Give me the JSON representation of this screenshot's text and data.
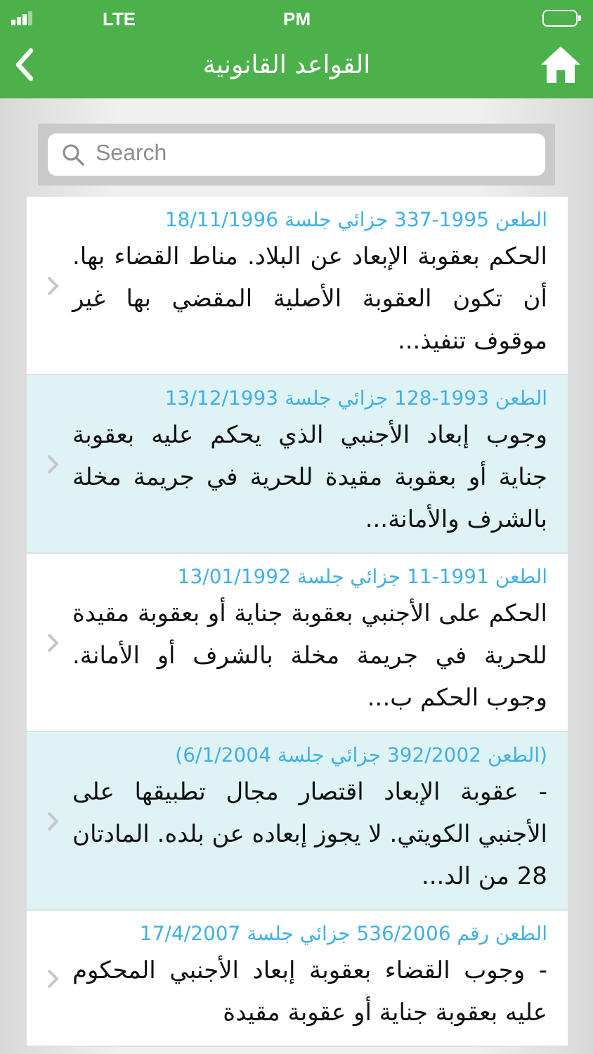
{
  "status_bar": {
    "network": "LTE",
    "time": "PM"
  },
  "nav_bar": {
    "title": "القواعد القانونية"
  },
  "search": {
    "placeholder": "Search"
  },
  "rulings": [
    {
      "header": "الطعن 1995-337 جزائي جلسة 18/11/1996",
      "summary": "الحكم بعقوبة الإبعاد عن البلاد. مناط القضاء بها. أن تكون العقوبة الأصلية المقضي بها غير موقوف تنفيذ..."
    },
    {
      "header": "الطعن 1993-128 جزائي جلسة 13/12/1993",
      "summary": "وجوب إبعاد الأجنبي الذي يحكم عليه بعقوبة جناية أو بعقوبة مقيدة للحرية في جريمة مخلة بالشرف والأمانة..."
    },
    {
      "header": "الطعن 1991-11 جزائي جلسة 13/01/1992",
      "summary": "الحكم على الأجنبي بعقوبة جناية أو بعقوبة مقيدة للحرية في جريمة مخلة بالشرف أو الأمانة. وجوب الحكم ب..."
    },
    {
      "header": "(الطعن 392/2002 جزائي جلسة 6/1/2004)",
      "summary": "- عقوبة الإبعاد اقتصار مجال تطبيقها على الأجنبي الكويتي. لا يجوز إبعاده عن بلده. المادتان 28 من الد..."
    },
    {
      "header": "الطعن رقم 536/2006 جزائي جلسة 17/4/2007",
      "summary": "- وجوب القضاء بعقوبة إبعاد الأجنبي المحكوم عليه بعقوبة جناية أو عقوبة مقيدة"
    }
  ]
}
